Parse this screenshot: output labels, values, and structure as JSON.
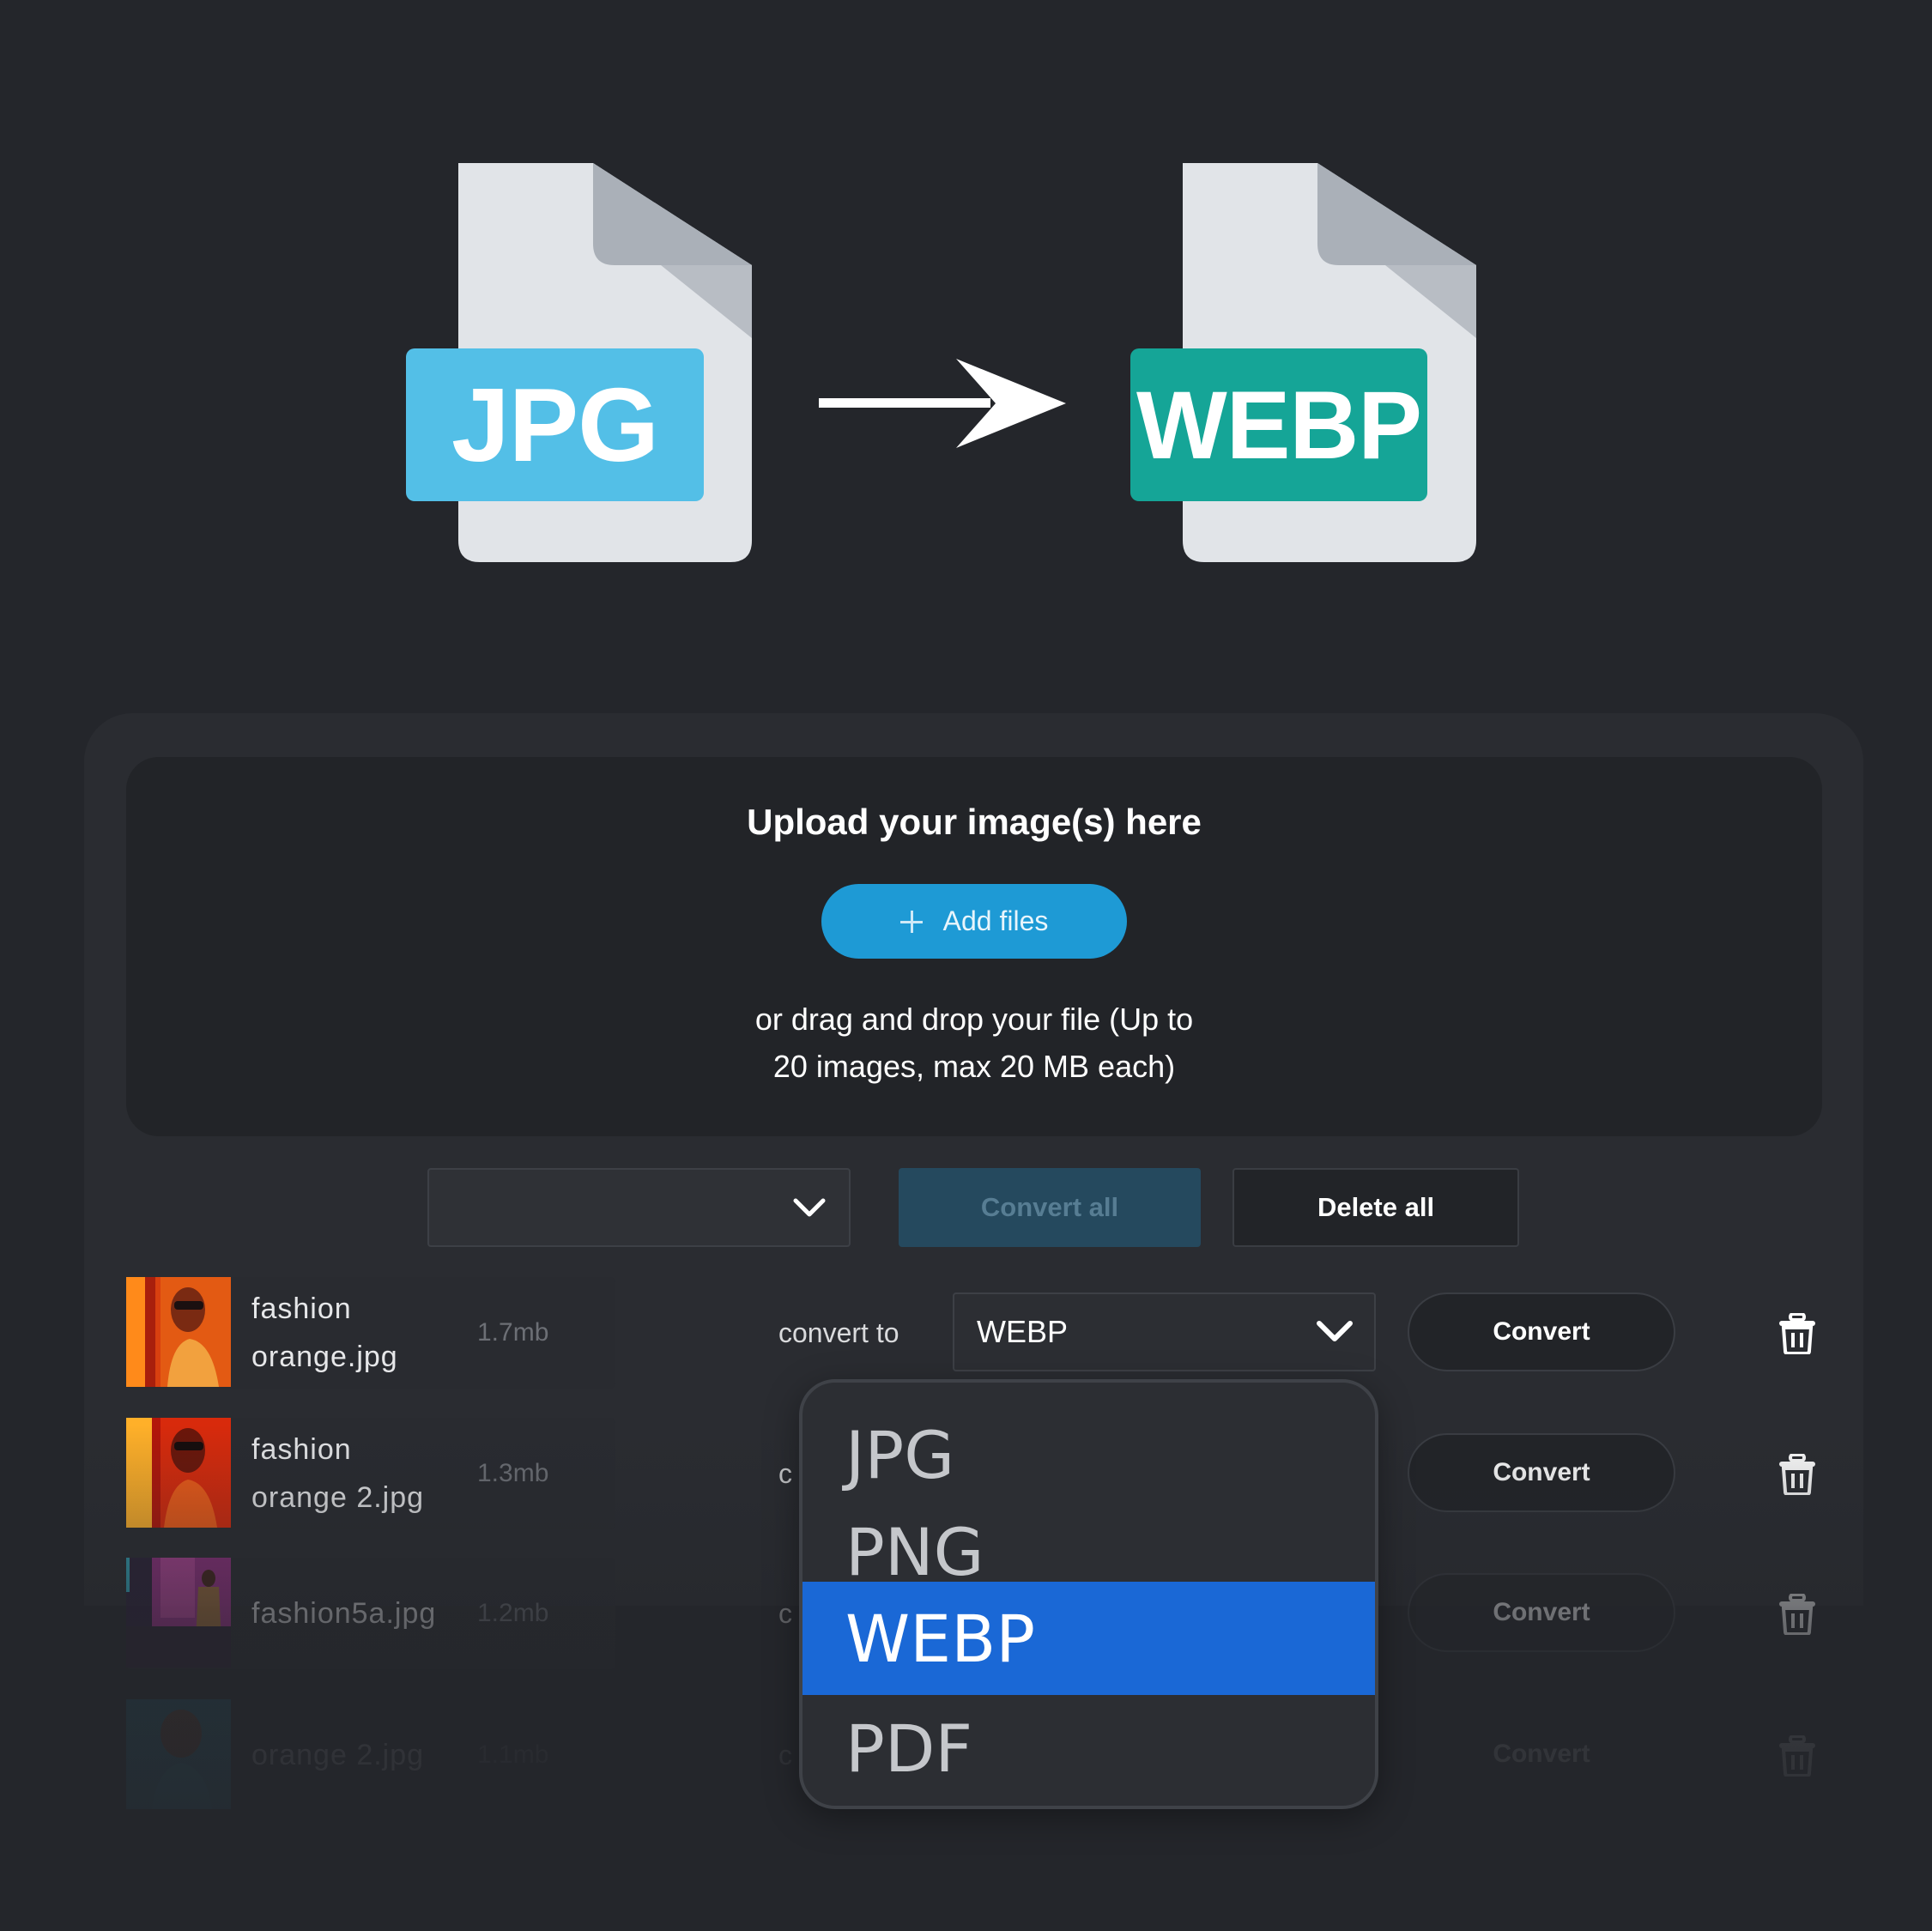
{
  "hero": {
    "source_format": "JPG",
    "target_format": "WEBP",
    "source_color": "#53bfe7",
    "target_color": "#15a597"
  },
  "uploader": {
    "title": "Upload your image(s) here",
    "add_files_label": "Add files",
    "drop_hint_line1": "or drag and drop your file (Up to",
    "drop_hint_line2": "20 images, max 20 MB each)",
    "accent_color": "#1e9ad5"
  },
  "toolbar": {
    "format_select_value": "",
    "convert_all_label": "Convert all",
    "delete_all_label": "Delete all"
  },
  "files": [
    {
      "name_line1": "fashion",
      "name_line2": "orange.jpg",
      "size": "1.7mb",
      "convert_to_label": "convert to",
      "selected_format": "WEBP",
      "convert_label": "Convert"
    },
    {
      "name_line1": "fashion",
      "name_line2": "orange 2.jpg",
      "size": "1.3mb",
      "convert_to_label": "c",
      "convert_label": "Convert"
    },
    {
      "name_line1": "fashion5a.jpg",
      "name_line2": "",
      "size": "1.2mb",
      "convert_to_label": "c",
      "convert_label": "Convert"
    },
    {
      "name_line1": "orange 2.jpg",
      "name_line2": "",
      "size": "1.1mb",
      "convert_to_label": "c",
      "convert_label": "Convert"
    }
  ],
  "format_dropdown": {
    "options": [
      "JPG",
      "PNG",
      "WEBP",
      "PDF"
    ],
    "highlighted": "WEBP",
    "highlight_color": "#1a68d6"
  }
}
